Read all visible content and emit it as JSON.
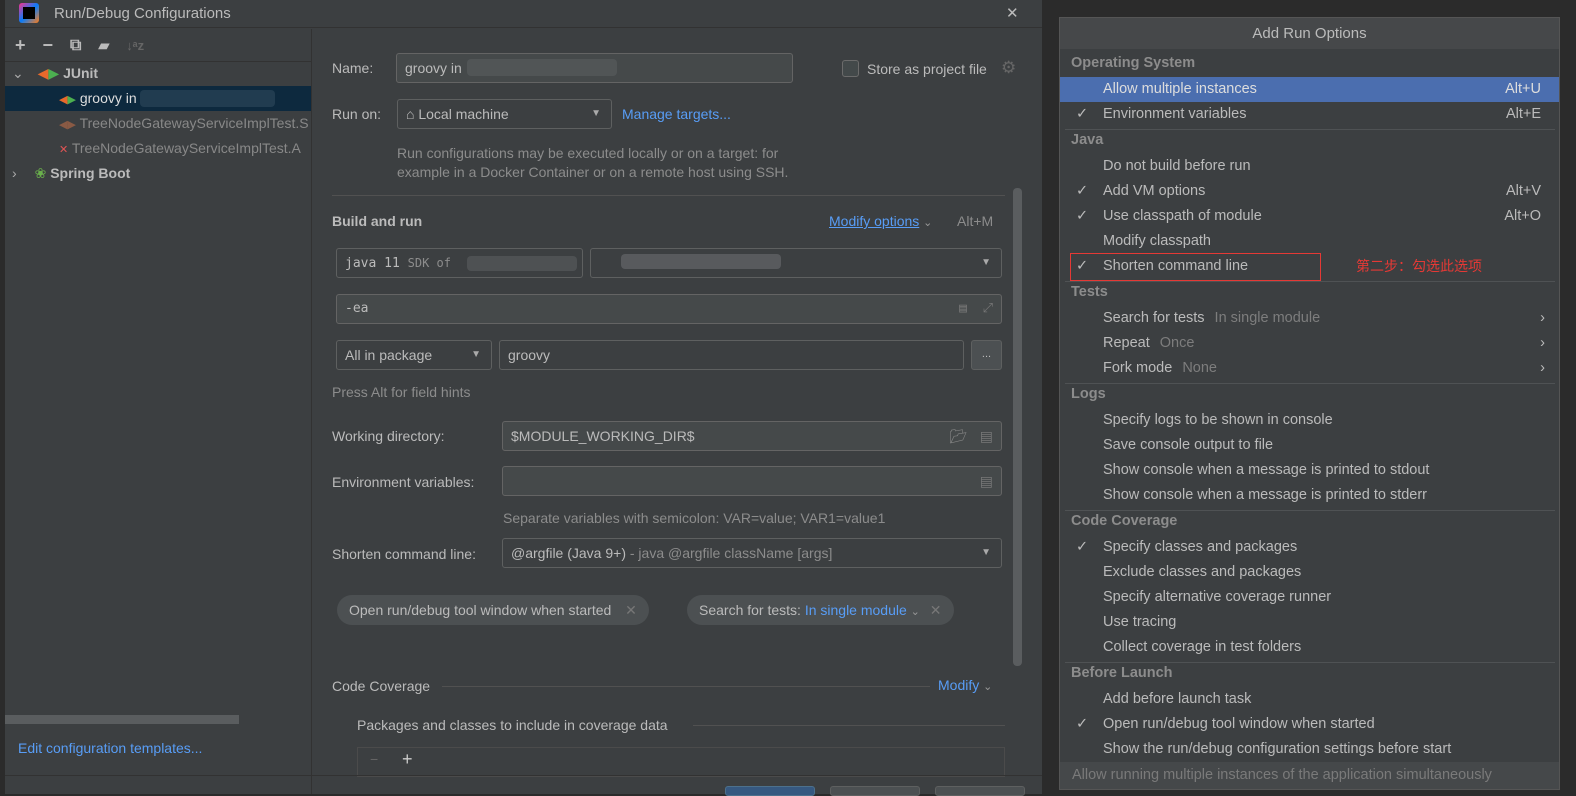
{
  "dialog": {
    "title": "Run/Debug Configurations",
    "close": "✕",
    "toolbar": {
      "add": "+",
      "remove": "−",
      "copy": "⧉",
      "folder": "▰",
      "sort": "↓ᵃz"
    },
    "tree": {
      "junit": "JUnit",
      "groovy": "groovy in",
      "test1": "TreeNodeGatewayServiceImplTest.S",
      "test2": "TreeNodeGatewayServiceImplTest.A",
      "spring_boot": "Spring Boot"
    },
    "edit_templates": "Edit configuration templates...",
    "name_label": "Name:",
    "name_value": "groovy in",
    "store_label": "Store as project file",
    "run_on_label": "Run on:",
    "run_on_value": "Local machine",
    "manage_targets": "Manage targets...",
    "run_on_hint_1": "Run configurations may be executed locally or on a target: for",
    "run_on_hint_2": "example in a Docker Container or on a remote host using SSH.",
    "build_and_run": "Build and run",
    "modify_options": "Modify options",
    "modify_shortcut": "Alt+M",
    "sdk_main": "java 11",
    "sdk_sub": "SDK of",
    "vm_options": "-ea",
    "test_kind": "All in package",
    "package_value": "groovy",
    "browse": "...",
    "field_hints": "Press Alt for field hints",
    "working_dir_label": "Working directory:",
    "working_dir_value": "$MODULE_WORKING_DIR$",
    "env_label": "Environment variables:",
    "env_hint": "Separate variables with semicolon: VAR=value; VAR1=value1",
    "shorten_label": "Shorten command line:",
    "shorten_value": "@argfile (Java 9+)",
    "shorten_hint": " - java @argfile className [args]",
    "chip1": "Open run/debug tool window when started",
    "chip2_label": "Search for tests: ",
    "chip2_value": "In single module",
    "code_coverage": "Code Coverage",
    "modify": "Modify",
    "coverage_packages": "Packages and classes to include in coverage data"
  },
  "popup": {
    "title": "Add Run Options",
    "groups": [
      {
        "title": "Operating System",
        "items": [
          {
            "label": "Allow multiple instances",
            "shortcut": "Alt+U",
            "selected": true
          },
          {
            "label": "Environment variables",
            "shortcut": "Alt+E",
            "checked": true
          }
        ]
      },
      {
        "title": "Java",
        "items": [
          {
            "label": "Do not build before run"
          },
          {
            "label": "Add VM options",
            "shortcut": "Alt+V",
            "checked": true
          },
          {
            "label": "Use classpath of module",
            "shortcut": "Alt+O",
            "checked": true
          },
          {
            "label": "Modify classpath"
          },
          {
            "label": "Shorten command line",
            "checked": true,
            "highlight": true
          }
        ]
      },
      {
        "title": "Tests",
        "items": [
          {
            "label": "Search for tests",
            "hint": "In single module",
            "submenu": true
          },
          {
            "label": "Repeat",
            "hint": "Once",
            "submenu": true
          },
          {
            "label": "Fork mode",
            "hint": "None",
            "submenu": true
          }
        ]
      },
      {
        "title": "Logs",
        "items": [
          {
            "label": "Specify logs to be shown in console"
          },
          {
            "label": "Save console output to file"
          },
          {
            "label": "Show console when a message is printed to stdout"
          },
          {
            "label": "Show console when a message is printed to stderr"
          }
        ]
      },
      {
        "title": "Code Coverage",
        "items": [
          {
            "label": "Specify classes and packages",
            "checked": true
          },
          {
            "label": "Exclude classes and packages"
          },
          {
            "label": "Specify alternative coverage runner"
          },
          {
            "label": "Use tracing"
          },
          {
            "label": "Collect coverage in test folders"
          }
        ]
      },
      {
        "title": "Before Launch",
        "items": [
          {
            "label": "Add before launch task"
          },
          {
            "label": "Open run/debug tool window when started",
            "checked": true
          },
          {
            "label": "Show the run/debug configuration settings before start"
          }
        ]
      }
    ],
    "footer": "Allow running multiple instances of the application simultaneously",
    "annotation": "第二步：勾选此选项",
    "annotation_color": "#e53935"
  }
}
